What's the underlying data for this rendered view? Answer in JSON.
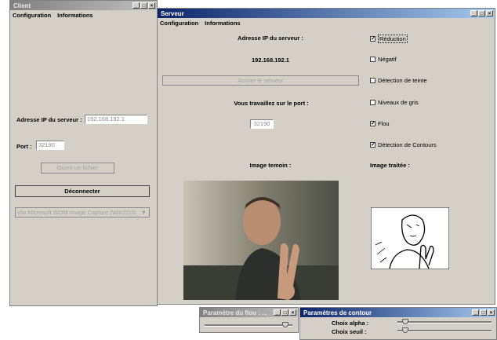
{
  "client": {
    "title": "Client",
    "menu": [
      "Configuration",
      "Informations"
    ],
    "ip_label": "Adresse IP du serveur :",
    "ip_value": "192.168.192.1",
    "port_label": "Port :",
    "port_value": "32190",
    "open_file_button": "Ouvrir un fichier",
    "disconnect_button": "Déconnecter",
    "device_select": "vfw:Microsoft WDM Image Capture (Win32):0"
  },
  "server": {
    "title": "Serveur",
    "menu": [
      "Configuration",
      "Informations"
    ],
    "ip_label": "Adresse IP du serveur :",
    "ip_value": "192.168.192.1",
    "activate_button": "Activer le serveur",
    "port_label": "Vous travaillez sur le port :",
    "port_value": "32190",
    "image_witness_label": "Image temoin :",
    "image_processed_label": "Image traitée :",
    "options": [
      {
        "label": "Réduction",
        "checked": true
      },
      {
        "label": "Négatif",
        "checked": false
      },
      {
        "label": "Détection de teinte",
        "checked": false
      },
      {
        "label": "Niveaux de gris",
        "checked": false
      },
      {
        "label": "Flou",
        "checked": true
      },
      {
        "label": "Détection de Contours",
        "checked": true
      }
    ]
  },
  "blur_params": {
    "title": "Paramètre du flou : ...",
    "level": 0.95
  },
  "contour_params": {
    "title": "Paramètres de contour",
    "alpha_label": "Choix alpha :",
    "alpha_level": 0.05,
    "threshold_label": "Choix seuil :",
    "threshold_level": 0.05
  },
  "colors": {
    "window_bg": "#d4d0c8",
    "title_active": "#0a246a",
    "title_inactive": "#808080"
  }
}
